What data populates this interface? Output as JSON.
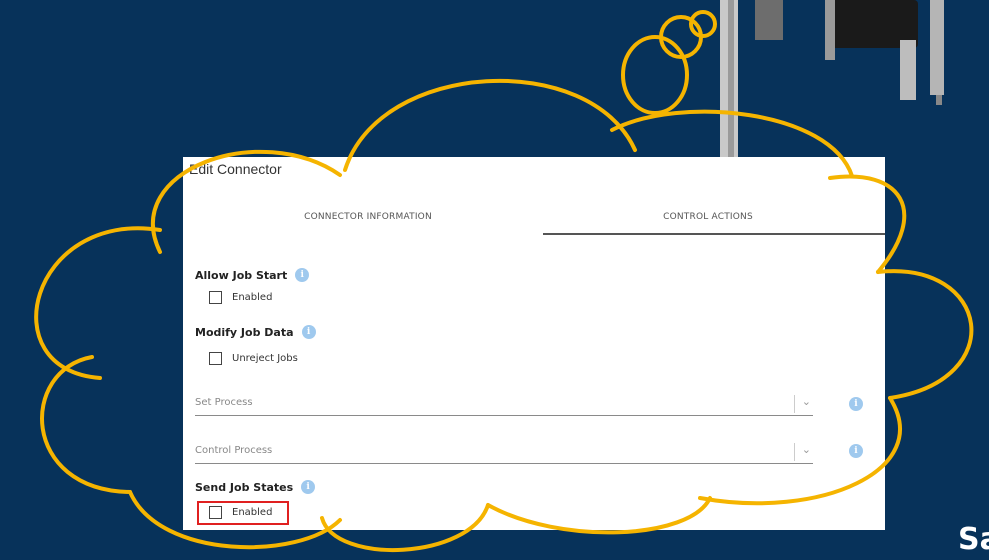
{
  "dialog": {
    "title": "Edit Connector",
    "tabs": [
      {
        "label": "CONNECTOR INFORMATION",
        "active": false
      },
      {
        "label": "CONTROL ACTIONS",
        "active": true
      }
    ]
  },
  "sections": {
    "allow_job_start": {
      "title": "Allow Job Start",
      "checkbox_label": "Enabled",
      "checked": false
    },
    "modify_job_data": {
      "title": "Modify Job Data",
      "checkbox_label": "Unreject Jobs",
      "checked": false
    },
    "send_job_states": {
      "title": "Send Job States",
      "checkbox_label": "Enabled",
      "checked": false
    }
  },
  "selects": {
    "set_process": {
      "placeholder": "Set Process"
    },
    "control_process": {
      "placeholder": "Control Process"
    }
  },
  "icons": {
    "info": "info-icon",
    "chevron": "chevron-down-icon"
  },
  "background_text": {
    "partial_word": "Sa"
  },
  "colors": {
    "background": "#07325a",
    "cloud_outline": "#f5b400",
    "info_icon": "#9fc9ee",
    "highlight": "#e02020"
  }
}
